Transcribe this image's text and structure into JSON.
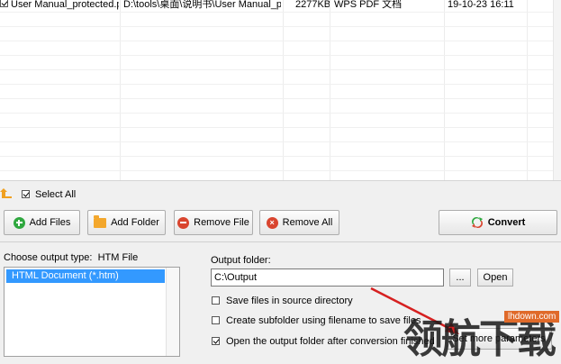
{
  "file_list": {
    "rows": [
      {
        "checked": true,
        "name": "User Manual_protected.pdf",
        "path": "D:\\tools\\桌面\\说明书\\User Manual_p...",
        "size": "2277KB",
        "type": "WPS PDF 文档",
        "date": "19-10-23 16:11"
      }
    ]
  },
  "select_all": {
    "label": "Select All",
    "checked": true
  },
  "buttons": {
    "add_files": "Add Files",
    "add_folder": "Add Folder",
    "remove_file": "Remove File",
    "remove_all": "Remove All",
    "convert": "Convert"
  },
  "output_type": {
    "label": "Choose output type:",
    "value": "HTM File",
    "options": [
      "HTML Document (*.htm)"
    ]
  },
  "output_folder": {
    "label": "Output folder:",
    "value": "C:\\Output",
    "browse": "...",
    "open": "Open"
  },
  "options": [
    {
      "label": "Save files in source directory",
      "checked": false
    },
    {
      "label": "Create subfolder using filename to save files",
      "checked": false
    },
    {
      "label": "Open the output folder after conversion finished",
      "checked": true
    }
  ],
  "set_more": "Set more parameters",
  "watermark": {
    "text": "领航下载",
    "url": "lhdown.com"
  },
  "colors": {
    "selection": "#3399ff",
    "add_icon": "#2fa83f",
    "remove_icon": "#d9452f",
    "folder_icon": "#f3a72c",
    "arrow": "#d62020"
  }
}
